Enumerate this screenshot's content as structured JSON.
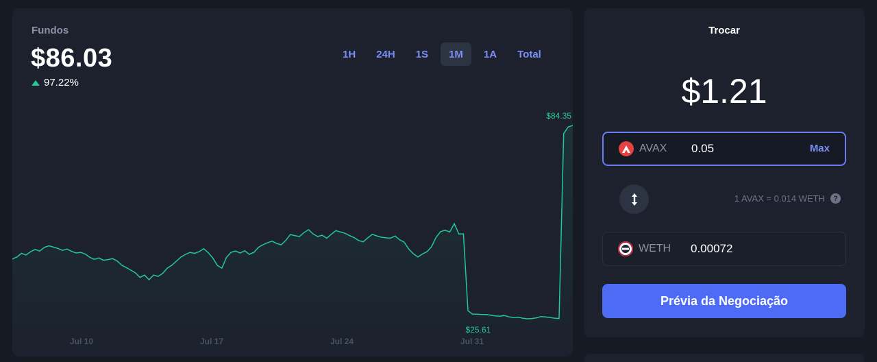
{
  "funds": {
    "label": "Fundos",
    "value": "$86.03",
    "change": "97.22%"
  },
  "range_tabs": [
    {
      "label": "1H",
      "active": false
    },
    {
      "label": "24H",
      "active": false
    },
    {
      "label": "1S",
      "active": false
    },
    {
      "label": "1M",
      "active": true
    },
    {
      "label": "1A",
      "active": false
    },
    {
      "label": "Total",
      "active": false
    }
  ],
  "chart_data": {
    "type": "area",
    "x_tick_labels": [
      "Jul 10",
      "Jul 17",
      "Jul 24",
      "Jul 31"
    ],
    "annotations": {
      "max_label": "$84.35",
      "min_label": "$25.61"
    },
    "values": [
      43.8,
      44.4,
      45.5,
      45.0,
      46.0,
      46.7,
      46.2,
      47.3,
      47.8,
      47.4,
      47.0,
      46.4,
      46.8,
      46.1,
      45.6,
      45.8,
      45.3,
      44.3,
      43.7,
      44.1,
      43.4,
      43.6,
      43.9,
      43.2,
      41.9,
      41.2,
      40.4,
      39.6,
      38.2,
      38.9,
      37.5,
      38.9,
      38.5,
      39.4,
      41.0,
      41.9,
      43.1,
      44.4,
      45.2,
      45.8,
      45.5,
      46.0,
      46.9,
      45.7,
      44.1,
      41.8,
      41.0,
      44.3,
      45.8,
      46.2,
      45.6,
      46.3,
      45.2,
      45.8,
      47.3,
      48.1,
      48.7,
      49.2,
      48.5,
      48.1,
      49.4,
      51.2,
      50.9,
      50.6,
      51.8,
      52.7,
      51.4,
      50.6,
      51.0,
      50.1,
      51.3,
      52.4,
      52.0,
      51.6,
      50.9,
      50.3,
      49.4,
      49.0,
      50.2,
      51.3,
      50.8,
      50.4,
      50.2,
      50.1,
      50.8,
      49.6,
      48.9,
      46.8,
      45.4,
      44.4,
      45.3,
      46.0,
      47.5,
      50.4,
      52.1,
      52.5,
      52.0,
      54.5,
      51.4,
      51.4,
      28.1,
      27.0,
      27.0,
      26.9,
      26.9,
      26.7,
      26.5,
      26.4,
      26.6,
      26.2,
      26.0,
      26.1,
      25.8,
      25.6,
      25.7,
      25.9,
      26.3,
      26.2,
      26.0,
      25.8,
      25.7,
      81.9,
      83.9,
      84.35
    ]
  },
  "swap": {
    "title": "Trocar",
    "amount": "$1.21",
    "from": {
      "symbol": "AVAX",
      "value": "0.05",
      "max_label": "Max",
      "icon": "avax-icon",
      "color": "#e84142"
    },
    "rate": "1 AVAX = 0.014 WETH",
    "to": {
      "symbol": "WETH",
      "value": "0.00072",
      "icon": "weth-icon"
    },
    "preview_button": "Prévia da Negociação"
  },
  "colors": {
    "accent": "#4d6bf5",
    "chart_line": "#23c993",
    "link": "#7b8ff5"
  }
}
